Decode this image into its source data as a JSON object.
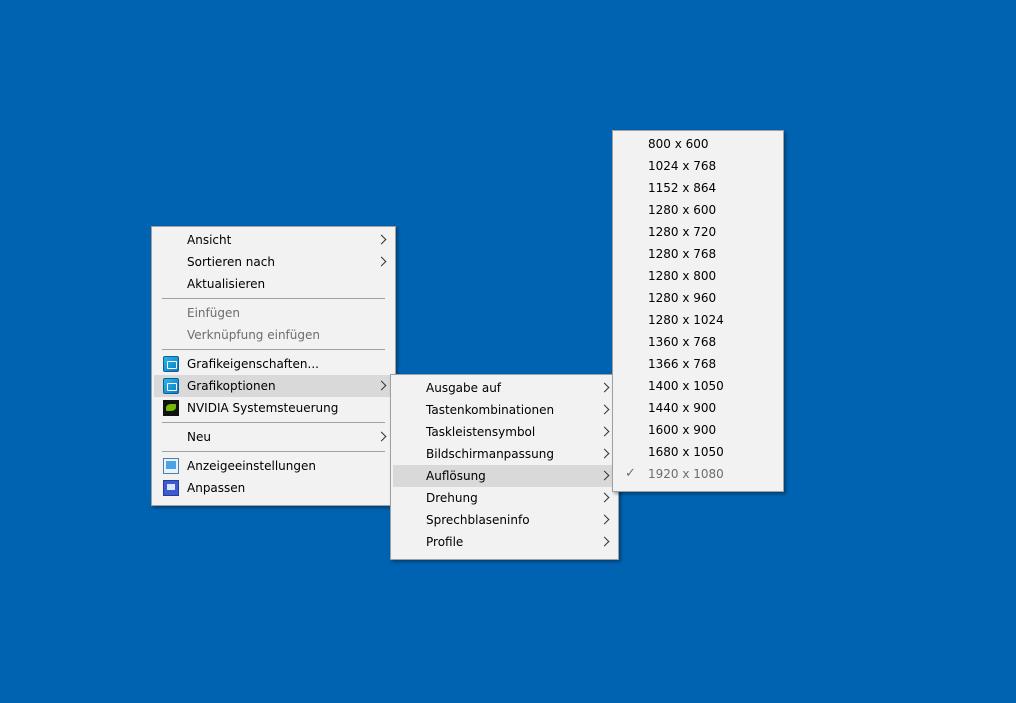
{
  "main_menu": {
    "items": [
      {
        "label": "Ansicht"
      },
      {
        "label": "Sortieren nach"
      },
      {
        "label": "Aktualisieren"
      },
      {
        "label": "Einfügen"
      },
      {
        "label": "Verknüpfung einfügen"
      },
      {
        "label": "Grafikeigenschaften..."
      },
      {
        "label": "Grafikoptionen"
      },
      {
        "label": "NVIDIA Systemsteuerung"
      },
      {
        "label": "Neu"
      },
      {
        "label": "Anzeigeeinstellungen"
      },
      {
        "label": "Anpassen"
      }
    ]
  },
  "grafikoptionen_menu": {
    "items": [
      {
        "label": "Ausgabe auf"
      },
      {
        "label": "Tastenkombinationen"
      },
      {
        "label": "Taskleistensymbol"
      },
      {
        "label": "Bildschirmanpassung"
      },
      {
        "label": "Auflösung"
      },
      {
        "label": "Drehung"
      },
      {
        "label": "Sprechblaseninfo"
      },
      {
        "label": "Profile"
      }
    ]
  },
  "aufloesung_menu": {
    "items": [
      {
        "label": "800 x 600"
      },
      {
        "label": "1024 x 768"
      },
      {
        "label": "1152 x 864"
      },
      {
        "label": "1280 x 600"
      },
      {
        "label": "1280 x 720"
      },
      {
        "label": "1280 x 768"
      },
      {
        "label": "1280 x 800"
      },
      {
        "label": "1280 x 960"
      },
      {
        "label": "1280 x 1024"
      },
      {
        "label": "1360 x 768"
      },
      {
        "label": "1366 x 768"
      },
      {
        "label": "1400 x 1050"
      },
      {
        "label": "1440 x 900"
      },
      {
        "label": "1600 x 900"
      },
      {
        "label": "1680 x 1050"
      },
      {
        "label": "1920 x 1080"
      }
    ],
    "checked_mark": "✓"
  },
  "icons": {
    "grafikeigenschaften": "intel-graphics-icon",
    "grafikoptionen": "intel-graphics-icon",
    "nvidia": "nvidia-icon",
    "anzeigeeinstellungen": "display-settings-icon",
    "anpassen": "personalize-icon"
  },
  "colors": {
    "desktop": "#0063b1",
    "menu_bg": "#f2f2f2",
    "highlight": "#d9d9d9",
    "disabled_text": "#6d6d6d"
  }
}
